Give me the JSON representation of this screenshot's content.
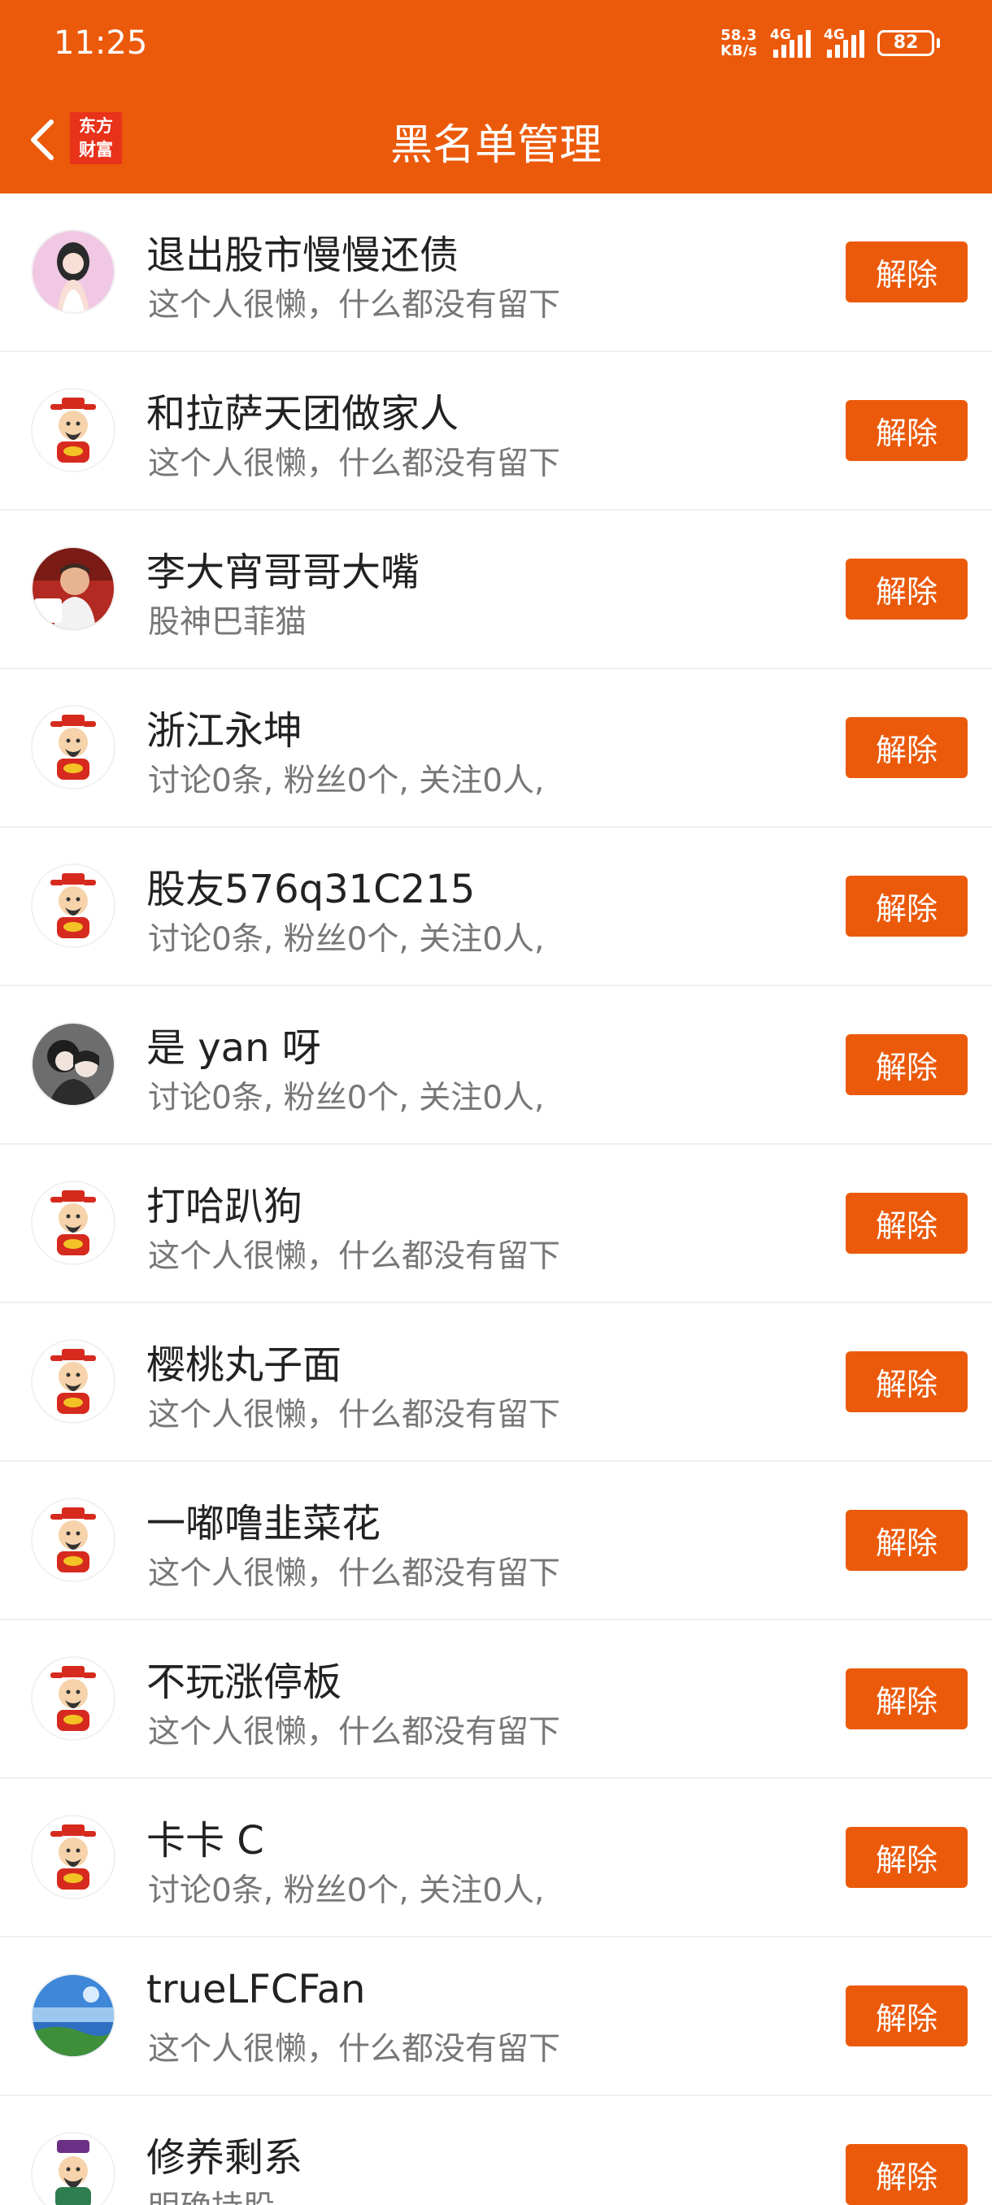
{
  "status_bar": {
    "time": "11:25",
    "net_speed_value": "58.3",
    "net_speed_unit": "KB/s",
    "signal1_label": "4G",
    "signal2_label": "4G",
    "battery": "82"
  },
  "header": {
    "title": "黑名单管理",
    "logo_line1": "东方",
    "logo_line2": "财富"
  },
  "colors": {
    "accent": "#eb5a0b",
    "logo_red": "#e8321a"
  },
  "list": {
    "unblock_label": "解除",
    "items": [
      {
        "name": "退出股市慢慢还债",
        "desc": "这个人很懒，什么都没有留下",
        "avatar": "photo-girl"
      },
      {
        "name": "和拉萨天团做家人",
        "desc": "这个人很懒，什么都没有留下",
        "avatar": "god-of-wealth"
      },
      {
        "name": "李大宵哥哥大嘴",
        "desc": "股神巴菲猫",
        "avatar": "photo-man"
      },
      {
        "name": "浙江永坤",
        "desc": "讨论0条, 粉丝0个, 关注0人,",
        "avatar": "god-of-wealth"
      },
      {
        "name": "股友576q31C215",
        "desc": "讨论0条, 粉丝0个, 关注0人,",
        "avatar": "god-of-wealth"
      },
      {
        "name": "是 yan 呀",
        "desc": "讨论0条, 粉丝0个, 关注0人,",
        "avatar": "photo-anime"
      },
      {
        "name": "打哈趴狗",
        "desc": "这个人很懒，什么都没有留下",
        "avatar": "god-of-wealth"
      },
      {
        "name": "樱桃丸子面",
        "desc": "这个人很懒，什么都没有留下",
        "avatar": "god-of-wealth"
      },
      {
        "name": "一嘟噜韭菜花",
        "desc": "这个人很懒，什么都没有留下",
        "avatar": "god-of-wealth"
      },
      {
        "name": "不玩涨停板",
        "desc": "这个人很懒，什么都没有留下",
        "avatar": "god-of-wealth"
      },
      {
        "name": "卡卡 C",
        "desc": "讨论0条, 粉丝0个, 关注0人,",
        "avatar": "god-of-wealth"
      },
      {
        "name": "trueLFCFan",
        "desc": "这个人很懒，什么都没有留下",
        "avatar": "photo-landscape"
      },
      {
        "name": "修养剩系",
        "desc": "明确持股",
        "avatar": "god-of-wealth-alt"
      }
    ]
  }
}
